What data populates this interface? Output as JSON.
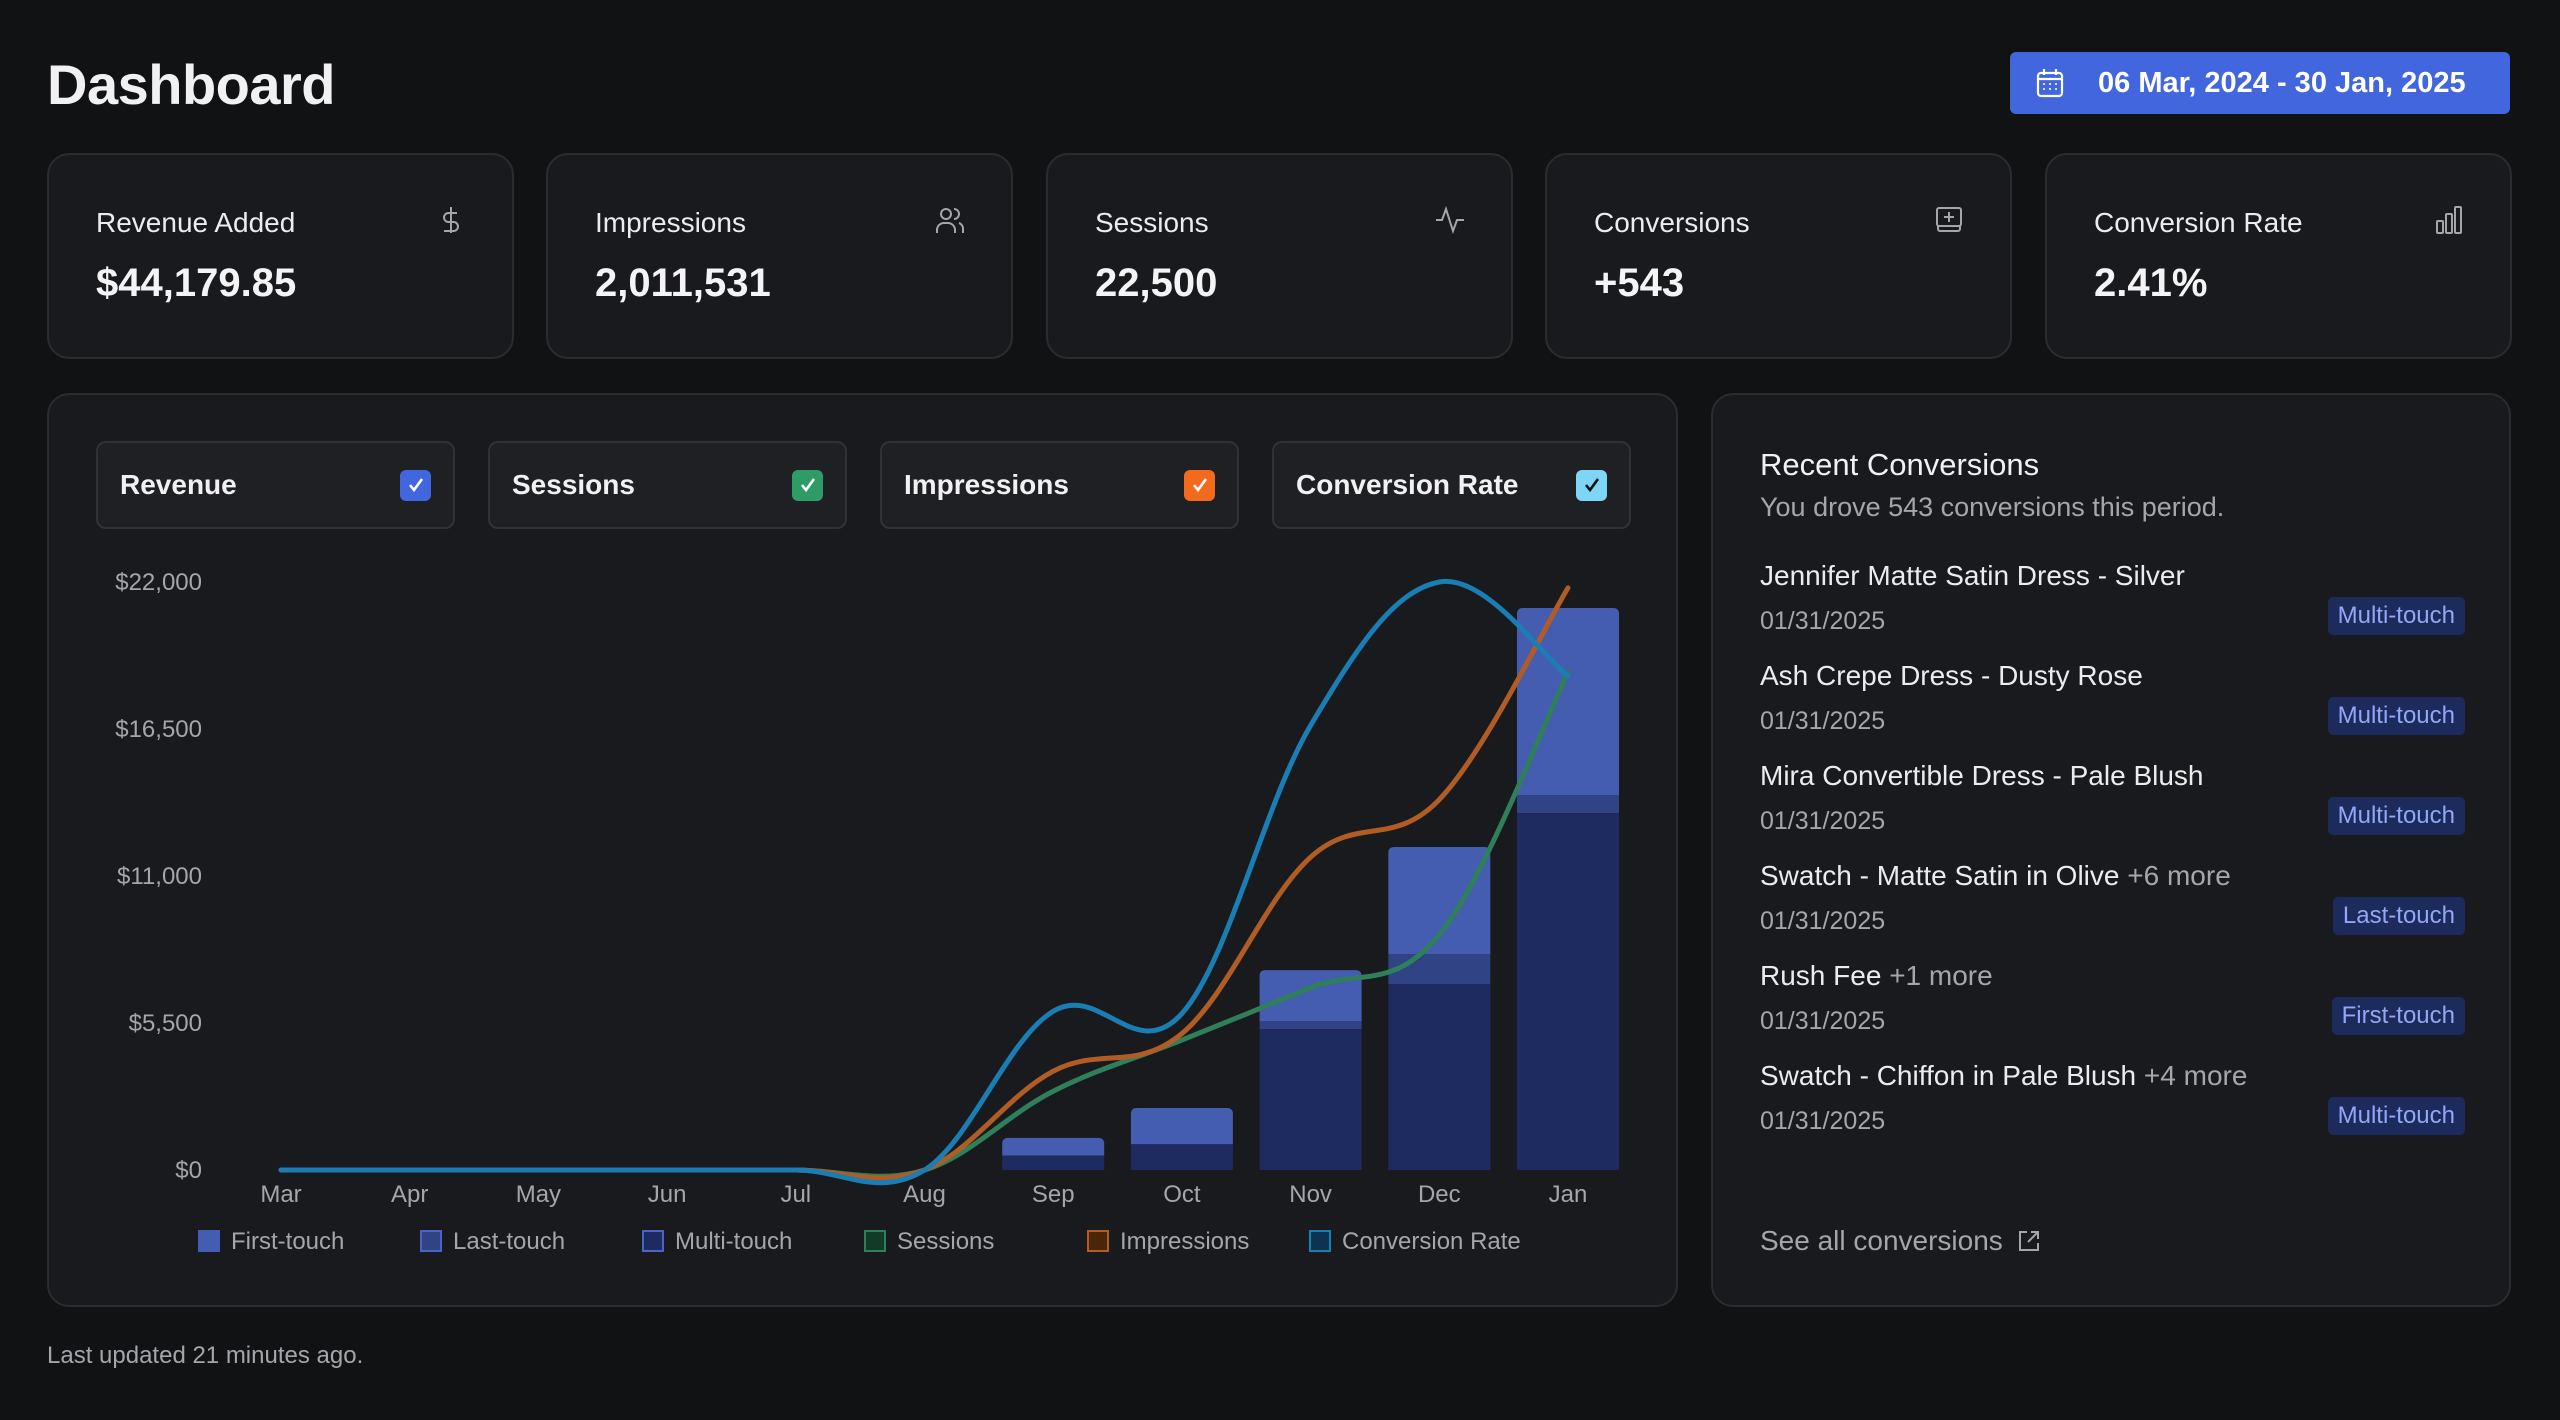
{
  "header": {
    "title": "Dashboard",
    "date_range": "06 Mar, 2024 - 30 Jan, 2025",
    "date_icon": "calendar-icon"
  },
  "kpis": [
    {
      "label": "Revenue Added",
      "value": "$44,179.85",
      "icon": "dollar-icon"
    },
    {
      "label": "Impressions",
      "value": "2,011,531",
      "icon": "users-icon"
    },
    {
      "label": "Sessions",
      "value": "22,500",
      "icon": "activity-icon"
    },
    {
      "label": "Conversions",
      "value": "+543",
      "icon": "plus-box-icon"
    },
    {
      "label": "Conversion Rate",
      "value": "2.41%",
      "icon": "bar-chart-icon"
    }
  ],
  "toggles": [
    {
      "label": "Revenue",
      "checked": true,
      "color": "#4166dd"
    },
    {
      "label": "Sessions",
      "checked": true,
      "color": "#2f9b67"
    },
    {
      "label": "Impressions",
      "checked": true,
      "color": "#f26b1d"
    },
    {
      "label": "Conversion Rate",
      "checked": true,
      "color": "#7ed6f7"
    }
  ],
  "colors": {
    "first_touch": "#445db0",
    "last_touch": "#304384",
    "multi_touch": "#1e2b60",
    "sessions": "#2f7f5b",
    "impressions": "#b05d25",
    "conversion_rate": "#1a7db3",
    "accent": "#4166dd"
  },
  "chart_data": {
    "type": "bar",
    "title": "",
    "xlabel": "",
    "ylabel": "Revenue",
    "ylim": [
      0,
      22000
    ],
    "yticks": [
      "$0",
      "$5,500",
      "$11,000",
      "$16,500",
      "$22,000"
    ],
    "ytick_values": [
      0,
      5500,
      11000,
      16500,
      22000
    ],
    "grid": false,
    "categories": [
      "Mar",
      "Apr",
      "May",
      "Jun",
      "Jul",
      "Aug",
      "Sep",
      "Oct",
      "Nov",
      "Dec",
      "Jan"
    ],
    "stacked_series": [
      {
        "name": "Multi-touch",
        "values": [
          0,
          0,
          0,
          0,
          0,
          0,
          520,
          970,
          5275,
          6960,
          13355
        ]
      },
      {
        "name": "Last-touch",
        "values": [
          0,
          0,
          0,
          0,
          0,
          0,
          30,
          0,
          300,
          1120,
          675
        ]
      },
      {
        "name": "First-touch",
        "values": [
          0,
          0,
          0,
          0,
          0,
          0,
          650,
          1350,
          1905,
          4005,
          6995
        ]
      }
    ],
    "line_series_note": "Lines plotted on independent normalized scales (fraction of plot height)",
    "line_series": [
      {
        "name": "Sessions",
        "values": [
          0,
          0,
          0,
          0,
          0,
          0,
          0.134,
          0.221,
          0.31,
          0.4,
          0.846
        ]
      },
      {
        "name": "Impressions",
        "values": [
          0,
          0,
          0,
          0,
          0,
          0,
          0.168,
          0.232,
          0.532,
          0.63,
          0.99
        ]
      },
      {
        "name": "Conversion Rate",
        "values": [
          0,
          0,
          0,
          0,
          0,
          0,
          0.27,
          0.266,
          0.756,
          1.0,
          0.84
        ]
      }
    ],
    "legend": [
      "First-touch",
      "Last-touch",
      "Multi-touch",
      "Sessions",
      "Impressions",
      "Conversion Rate"
    ],
    "legend_position": "bottom"
  },
  "recent": {
    "title": "Recent Conversions",
    "subtitle": "You drove 543 conversions this period.",
    "items": [
      {
        "name": "Jennifer Matte Satin Dress - Silver",
        "more": "",
        "date": "01/31/2025",
        "badge": "Multi-touch"
      },
      {
        "name": "Ash Crepe Dress - Dusty Rose",
        "more": "",
        "date": "01/31/2025",
        "badge": "Multi-touch"
      },
      {
        "name": "Mira Convertible Dress - Pale Blush",
        "more": "",
        "date": "01/31/2025",
        "badge": "Multi-touch"
      },
      {
        "name": "Swatch - Matte Satin in Olive",
        "more": "+6 more",
        "date": "01/31/2025",
        "badge": "Last-touch"
      },
      {
        "name": "Rush Fee",
        "more": "+1 more",
        "date": "01/31/2025",
        "badge": "First-touch"
      },
      {
        "name": "Swatch - Chiffon in Pale Blush",
        "more": "+4 more",
        "date": "01/31/2025",
        "badge": "Multi-touch"
      }
    ],
    "see_all": "See all conversions"
  },
  "footer": {
    "updated": "Last updated 21 minutes ago."
  }
}
